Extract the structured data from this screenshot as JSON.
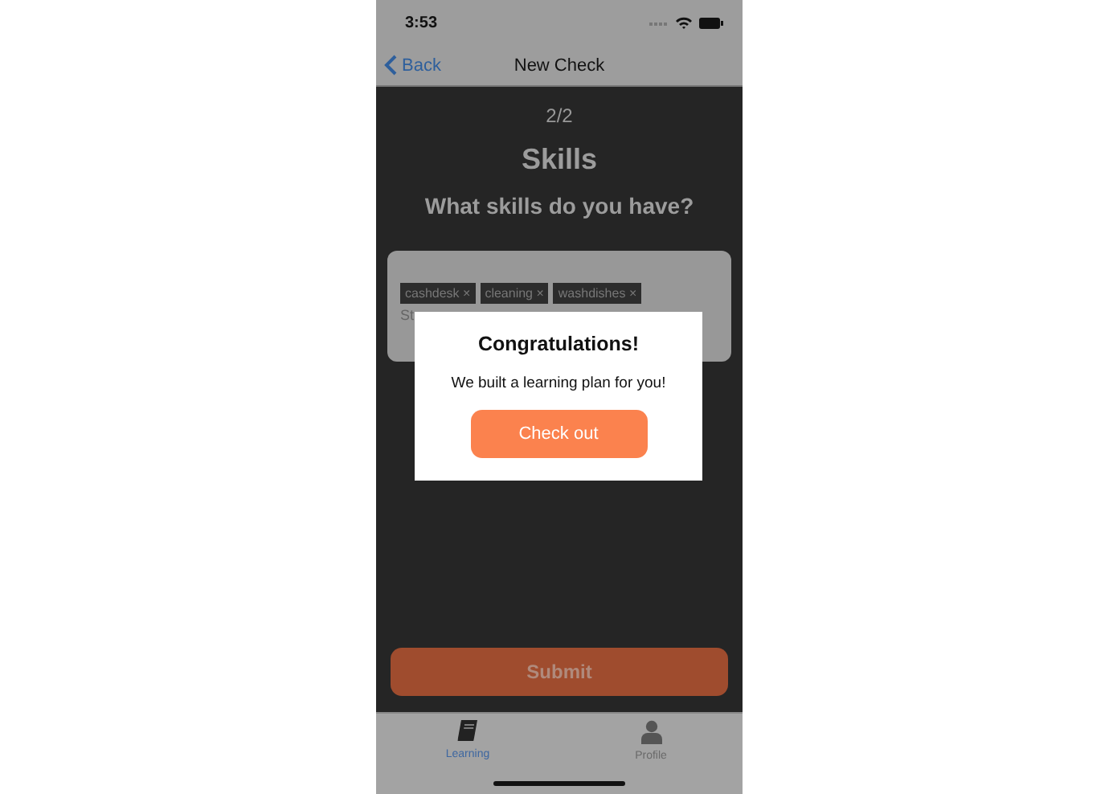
{
  "status_bar": {
    "time": "3:53"
  },
  "nav": {
    "back": "Back",
    "title": "New Check"
  },
  "step": "2/2",
  "heading": "Skills",
  "question": "What skills do you have?",
  "skills_field": {
    "tags": [
      {
        "label": "cashdesk",
        "remove": "×"
      },
      {
        "label": "cleaning",
        "remove": "×"
      },
      {
        "label": "washdishes",
        "remove": "×"
      }
    ],
    "placeholder": "St"
  },
  "submit": "Submit",
  "dialog": {
    "title": "Congratulations!",
    "message": "We built a learning plan for you!",
    "button": "Check out"
  },
  "tab_bar": [
    {
      "label": "Learning",
      "selected": true
    },
    {
      "label": "Profile",
      "selected": false
    }
  ]
}
